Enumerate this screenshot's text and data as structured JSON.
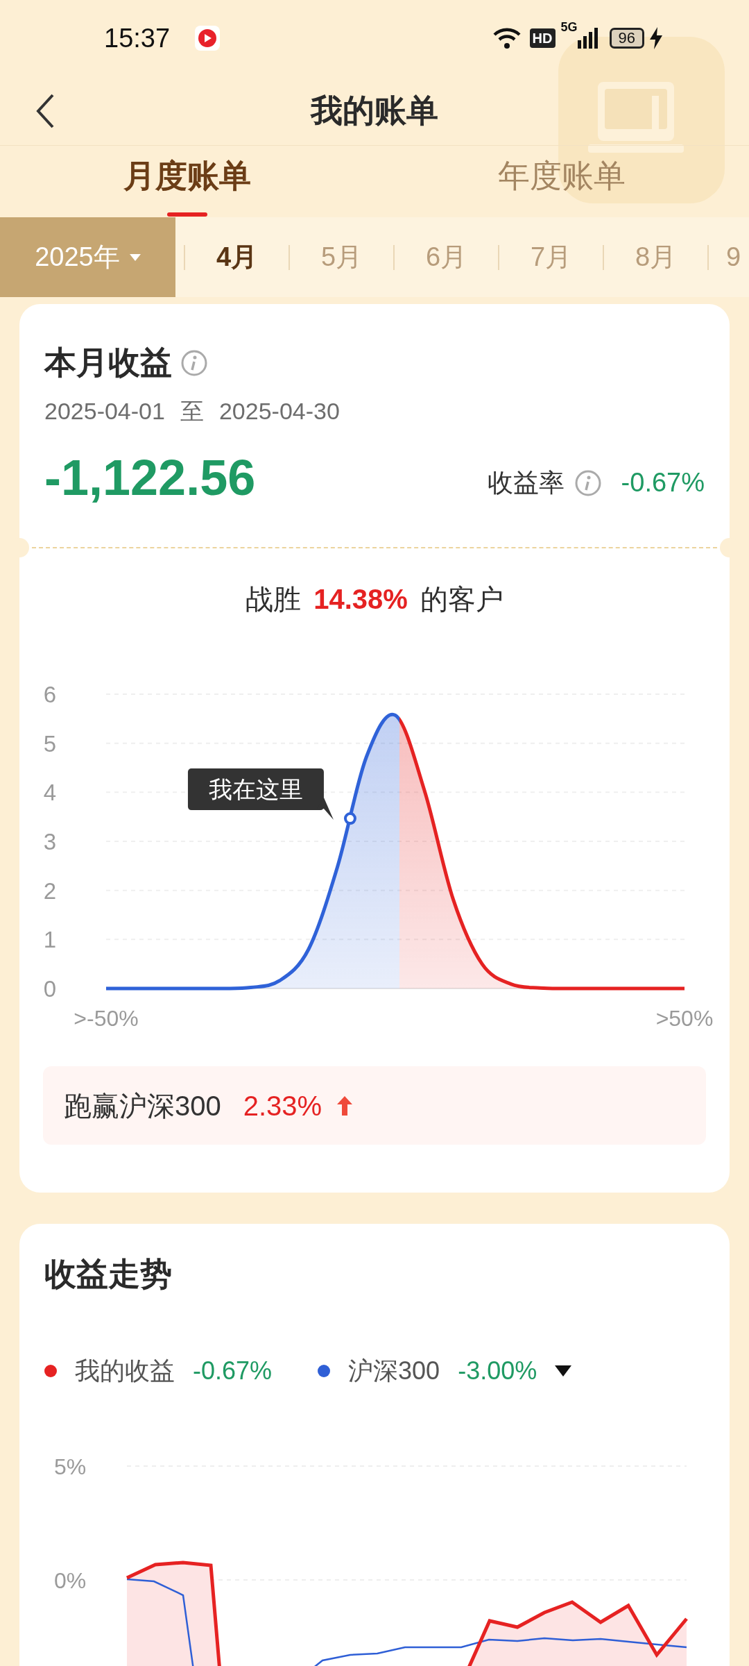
{
  "status_bar": {
    "time": "15:37",
    "network_badge": "HD",
    "network_type": "5G",
    "battery": "96"
  },
  "header": {
    "title": "我的账单"
  },
  "tabs": [
    {
      "label": "月度账单",
      "selected": true
    },
    {
      "label": "年度账单",
      "selected": false
    }
  ],
  "period": {
    "year": "2025年",
    "months": [
      {
        "label": "4月",
        "selected": true
      },
      {
        "label": "5月",
        "selected": false
      },
      {
        "label": "6月",
        "selected": false
      },
      {
        "label": "7月",
        "selected": false
      },
      {
        "label": "8月",
        "selected": false
      },
      {
        "label": "9",
        "selected": false
      }
    ]
  },
  "summary": {
    "title": "本月收益",
    "date_from": "2025-04-01",
    "date_separator": "至",
    "date_to": "2025-04-30",
    "amount": "-1,122.56",
    "rate_label": "收益率",
    "rate": "-0.67%"
  },
  "ranking": {
    "prefix": "战胜",
    "percent": "14.38%",
    "suffix": "的客户",
    "chart_data": {
      "type": "area",
      "grid": true,
      "categories": [
        ">-50%",
        null,
        null,
        null,
        null,
        null,
        null,
        null,
        null,
        null,
        null,
        null,
        null,
        null,
        null,
        null,
        null,
        null,
        null,
        null,
        ">50%"
      ],
      "values": [
        0,
        0,
        0,
        0,
        0,
        0.02,
        0.16,
        0.8,
        2.48,
        4.72,
        5.57,
        4.05,
        1.82,
        0.5,
        0.09,
        0.01,
        0,
        0,
        0,
        0,
        0
      ],
      "ylim": [
        0,
        6
      ],
      "yticks": [
        0,
        1,
        2,
        3,
        4,
        5,
        6
      ],
      "annotations": [
        "我在这里"
      ]
    },
    "marker": {
      "level": 0.422
    },
    "benchmark_label": "跑赢沪深300",
    "benchmark_value": "2.33%"
  },
  "trend": {
    "title": "收益走势",
    "legend": [
      {
        "name": "我的收益",
        "value": "-0.67%",
        "color": "#e62222"
      },
      {
        "name": "沪深300",
        "value": "-3.00%",
        "color": "#2f5fd6"
      }
    ],
    "y_ticks": [
      "5%",
      "0%"
    ]
  }
}
